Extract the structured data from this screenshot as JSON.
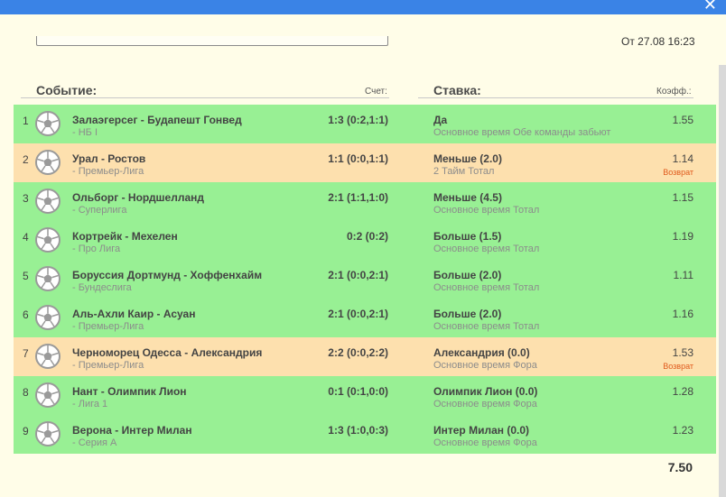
{
  "header": {
    "close_icon": "close-icon",
    "date_text": "От 27.08 16:23"
  },
  "columns": {
    "event": "Событие:",
    "score": "Счет:",
    "bet": "Ставка:",
    "odds": "Коэфф.:"
  },
  "colors": {
    "win": "#98f094",
    "return": "#fde0ae",
    "return_text": "#e05a1c",
    "topbar": "#3a83e6"
  },
  "rows": [
    {
      "n": "1",
      "match": "Залаэгерсег - Будапешт Гонвед",
      "league": "- НБ I",
      "score": "1:3 (0:2,1:1)",
      "bet": "Да",
      "market": "Основное время Обе команды забьют",
      "odds": "1.55",
      "status": "",
      "row_color": "green"
    },
    {
      "n": "2",
      "match": "Урал - Ростов",
      "league": "- Премьер-Лига",
      "score": "1:1 (0:0,1:1)",
      "bet": "Меньше (2.0)",
      "market": "2 Тайм Тотал",
      "odds": "1.14",
      "status": "Возврат",
      "row_color": "orange"
    },
    {
      "n": "3",
      "match": "Ольборг - Нордшелланд",
      "league": "- Суперлига",
      "score": "2:1 (1:1,1:0)",
      "bet": "Меньше (4.5)",
      "market": "Основное время Тотал",
      "odds": "1.15",
      "status": "",
      "row_color": "green"
    },
    {
      "n": "4",
      "match": "Кортрейк - Мехелен",
      "league": "- Про Лига",
      "score": "0:2 (0:2)",
      "bet": "Больше (1.5)",
      "market": "Основное время Тотал",
      "odds": "1.19",
      "status": "",
      "row_color": "green"
    },
    {
      "n": "5",
      "match": "Боруссия Дортмунд - Хоффенхайм",
      "league": "- Бундеслига",
      "score": "2:1 (0:0,2:1)",
      "bet": "Больше (2.0)",
      "market": "Основное время Тотал",
      "odds": "1.11",
      "status": "",
      "row_color": "green"
    },
    {
      "n": "6",
      "match": "Аль-Ахли Каир - Асуан",
      "league": "- Премьер-Лига",
      "score": "2:1 (0:0,2:1)",
      "bet": "Больше (2.0)",
      "market": "Основное время Тотал",
      "odds": "1.16",
      "status": "",
      "row_color": "green"
    },
    {
      "n": "7",
      "match": "Черноморец Одесса - Александрия",
      "league": "- Премьер-Лига",
      "score": "2:2 (0:0,2:2)",
      "bet": "Александрия (0.0)",
      "market": "Основное время Фора",
      "odds": "1.53",
      "status": "Возврат",
      "row_color": "orange"
    },
    {
      "n": "8",
      "match": "Нант - Олимпик Лион",
      "league": "- Лига 1",
      "score": "0:1 (0:1,0:0)",
      "bet": "Олимпик Лион (0.0)",
      "market": "Основное время Фора",
      "odds": "1.28",
      "status": "",
      "row_color": "green"
    },
    {
      "n": "9",
      "match": "Верона - Интер Милан",
      "league": "- Серия А",
      "score": "1:3 (1:0,0:3)",
      "bet": "Интер Милан (0.0)",
      "market": "Основное время Фора",
      "odds": "1.23",
      "status": "",
      "row_color": "green"
    }
  ],
  "total": "7.50"
}
